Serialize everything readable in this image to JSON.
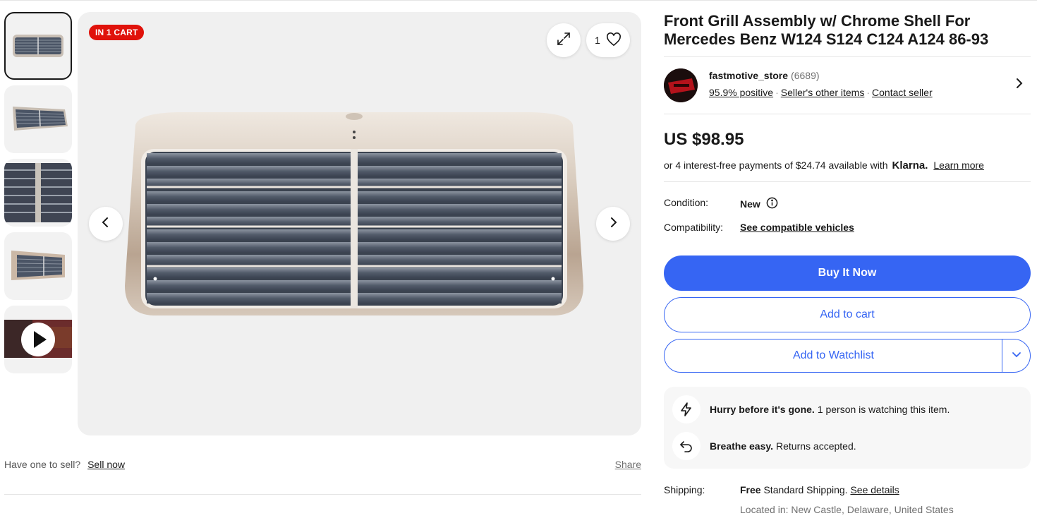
{
  "gallery": {
    "badge": "IN 1 CART",
    "watch_count": "1",
    "thumbnails": [
      "grill-front",
      "grill-angle",
      "grill-closeup",
      "grill-side",
      "video"
    ]
  },
  "below_image": {
    "prompt": "Have one to sell?",
    "sell_link": "Sell now",
    "share": "Share"
  },
  "listing": {
    "title": "Front Grill Assembly w/ Chrome Shell For Mercedes Benz W124 S124 C124 A124 86-93"
  },
  "seller": {
    "name": "fastmotive_store",
    "feedback": "(6689)",
    "positive": "95.9% positive",
    "other_items": "Seller's other items",
    "contact": "Contact seller"
  },
  "price": {
    "amount": "US $98.95",
    "klarna_prefix": "or 4 interest-free payments of $24.74 available with",
    "klarna_brand": "Klarna.",
    "learn_more": "Learn more"
  },
  "details": {
    "condition_label": "Condition:",
    "condition_value": "New",
    "compat_label": "Compatibility:",
    "compat_value": "See compatible vehicles"
  },
  "buttons": {
    "buy_now": "Buy It Now",
    "add_to_cart": "Add to cart",
    "add_to_watchlist": "Add to Watchlist"
  },
  "signals": {
    "hurry_bold": "Hurry before it's gone.",
    "hurry_text": "1 person is watching this item.",
    "breathe_bold": "Breathe easy.",
    "breathe_text": "Returns accepted."
  },
  "shipping": {
    "label": "Shipping:",
    "free": "Free",
    "method": "Standard Shipping.",
    "details_link": "See details",
    "location": "Located in: New Castle, Delaware, United States"
  },
  "colors": {
    "primary": "#3665f3",
    "badge_red": "#e0120b"
  }
}
